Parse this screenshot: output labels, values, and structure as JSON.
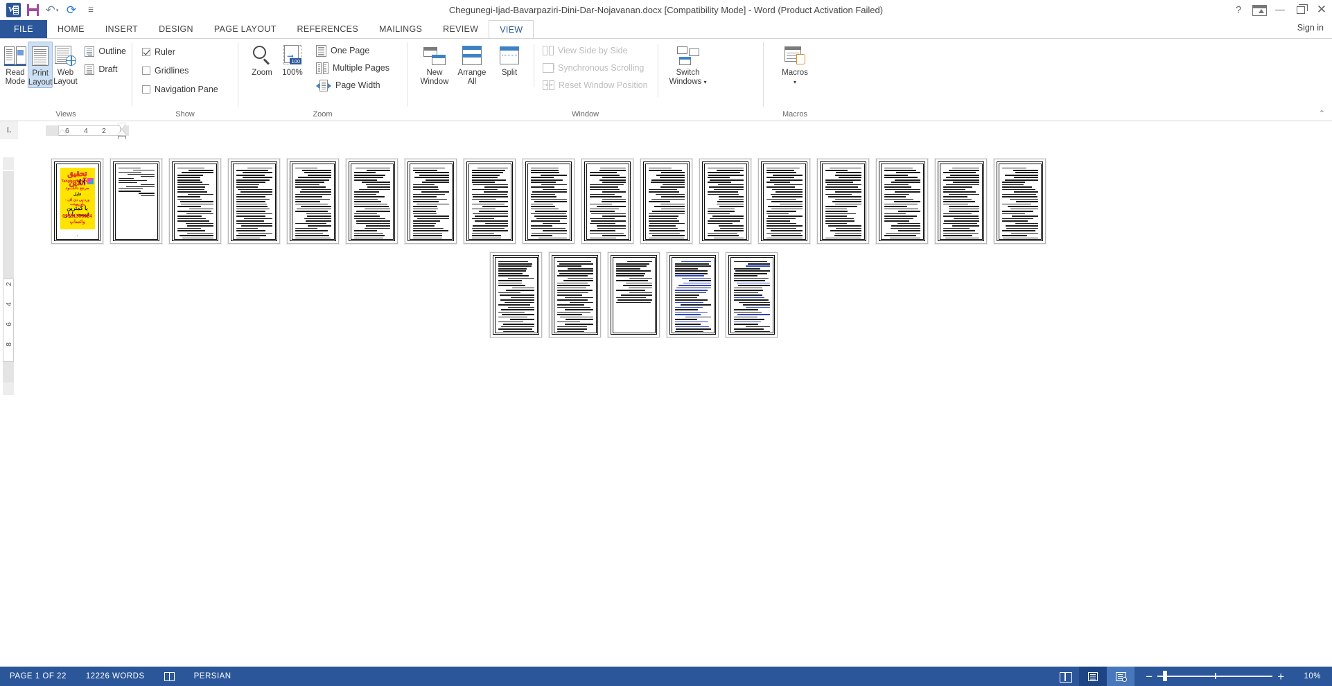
{
  "window": {
    "title": "Chegunegi-Ijad-Bavarpaziri-Dini-Dar-Nojavanan.docx [Compatibility Mode] - Word (Product Activation Failed)",
    "signin_label": "Sign in",
    "quick_access": [
      {
        "name": "word-logo",
        "label": "W"
      },
      {
        "name": "save-icon",
        "label": "Save"
      },
      {
        "name": "undo-icon",
        "label": "Undo"
      },
      {
        "name": "redo-icon",
        "label": "Repeat"
      },
      {
        "name": "customize-qat-icon",
        "label": "Customize Quick Access Toolbar"
      }
    ],
    "controls": [
      {
        "name": "help-button",
        "label": "?"
      },
      {
        "name": "ribbon-display-options-button",
        "label": "Ribbon Display Options"
      },
      {
        "name": "minimize-button",
        "label": "Minimize"
      },
      {
        "name": "restore-button",
        "label": "Restore Down"
      },
      {
        "name": "close-button",
        "label": "✕"
      }
    ]
  },
  "tabs": [
    {
      "label": "FILE",
      "active": false,
      "file": true
    },
    {
      "label": "HOME",
      "active": false
    },
    {
      "label": "INSERT",
      "active": false
    },
    {
      "label": "DESIGN",
      "active": false
    },
    {
      "label": "PAGE LAYOUT",
      "active": false
    },
    {
      "label": "REFERENCES",
      "active": false
    },
    {
      "label": "MAILINGS",
      "active": false
    },
    {
      "label": "REVIEW",
      "active": false
    },
    {
      "label": "VIEW",
      "active": true
    }
  ],
  "ribbon": {
    "collapse_label": "⌃",
    "groups": {
      "views": {
        "label": "Views",
        "buttons": [
          {
            "label_line1": "Read",
            "label_line2": "Mode",
            "name": "read-mode-button",
            "selected": false
          },
          {
            "label_line1": "Print",
            "label_line2": "Layout",
            "name": "print-layout-button",
            "selected": true
          },
          {
            "label_line1": "Web",
            "label_line2": "Layout",
            "name": "web-layout-button",
            "selected": false
          }
        ],
        "small": [
          {
            "label": "Outline",
            "name": "outline-view-button"
          },
          {
            "label": "Draft",
            "name": "draft-view-button"
          }
        ]
      },
      "show": {
        "label": "Show",
        "checks": [
          {
            "label": "Ruler",
            "checked": true,
            "name": "ruler-checkbox"
          },
          {
            "label": "Gridlines",
            "checked": false,
            "name": "gridlines-checkbox"
          },
          {
            "label": "Navigation Pane",
            "checked": false,
            "name": "navigation-pane-checkbox"
          }
        ]
      },
      "zoom": {
        "label": "Zoom",
        "buttons": [
          {
            "label": "Zoom",
            "name": "zoom-button"
          },
          {
            "label": "100%",
            "badge": "100",
            "name": "zoom-100-button"
          }
        ],
        "small": [
          {
            "label": "One Page",
            "name": "one-page-button"
          },
          {
            "label": "Multiple Pages",
            "name": "multiple-pages-button"
          },
          {
            "label": "Page Width",
            "name": "page-width-button"
          }
        ]
      },
      "window": {
        "label": "Window",
        "buttons": [
          {
            "label_line1": "New",
            "label_line2": "Window",
            "name": "new-window-button"
          },
          {
            "label_line1": "Arrange",
            "label_line2": "All",
            "name": "arrange-all-button"
          },
          {
            "label_line1": "Split",
            "label_line2": "",
            "name": "split-button"
          }
        ],
        "small": [
          {
            "label": "View Side by Side",
            "disabled": true,
            "name": "view-side-by-side-button"
          },
          {
            "label": "Synchronous Scrolling",
            "disabled": true,
            "name": "synchronous-scrolling-button"
          },
          {
            "label": "Reset Window Position",
            "disabled": true,
            "name": "reset-window-position-button"
          }
        ],
        "switch": {
          "label_line1": "Switch",
          "label_line2": "Windows",
          "name": "switch-windows-button"
        }
      },
      "macros": {
        "label": "Macros",
        "button": {
          "label": "Macros",
          "name": "macros-button"
        }
      }
    }
  },
  "rulers": {
    "tab_selector": "L",
    "horizontal_numbers": [
      "6",
      "4",
      "2"
    ],
    "vertical_numbers": [
      "2",
      "4",
      "6",
      "8"
    ]
  },
  "document": {
    "page_count": 22,
    "row1_pages": 17,
    "row2_pages": 5,
    "ad_page": {
      "title": "تحقیق آنلاین",
      "site": "Tahghighonline.ir",
      "line3": "مرجع دانلـــود",
      "line4": "فایل",
      "line5": "ورد-پی دی اف - پاورپوینت",
      "line6": "با کمترین قیمت بازار",
      "line7": "09981366624 واتساپ"
    }
  },
  "statusbar": {
    "page_label": "PAGE 1 OF 22",
    "words_label": "12226 WORDS",
    "proofing_name": "proofing-errors-icon",
    "language_label": "PERSIAN",
    "views": [
      {
        "name": "read-mode-view-button",
        "label": "Read Mode"
      },
      {
        "name": "print-layout-view-button",
        "label": "Print Layout"
      },
      {
        "name": "web-layout-view-button",
        "label": "Web Layout"
      }
    ],
    "zoom_out_label": "−",
    "zoom_in_label": "+",
    "zoom_percent": "10%"
  },
  "colors": {
    "accent": "#2b579a",
    "ribbon_selected": "#cde0f5",
    "ad_background": "#ffe400",
    "ad_red": "#e01b1b"
  }
}
